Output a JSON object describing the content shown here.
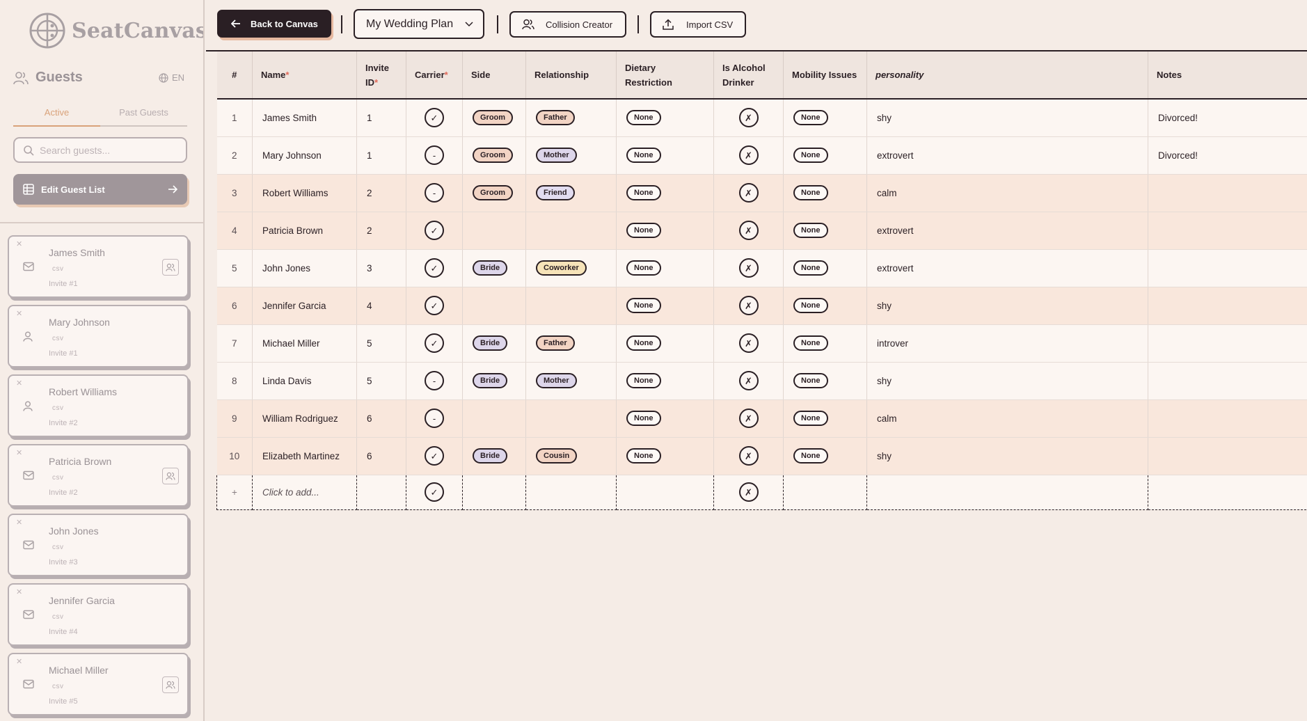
{
  "brand": {
    "name": "SeatCanvas"
  },
  "sidebar": {
    "title": "Guests",
    "lang": "EN",
    "tabs": [
      "Active",
      "Past Guests"
    ],
    "search_placeholder": "Search guests...",
    "edit_button": "Edit Guest List",
    "guests": [
      {
        "name": "James Smith",
        "source": "csv",
        "invite": "Invite #1",
        "icon": "envelope-icon",
        "group": true
      },
      {
        "name": "Mary Johnson",
        "source": "csv",
        "invite": "Invite #1",
        "icon": "person-icon",
        "group": false
      },
      {
        "name": "Robert Williams",
        "source": "csv",
        "invite": "Invite #2",
        "icon": "person-icon",
        "group": false
      },
      {
        "name": "Patricia Brown",
        "source": "csv",
        "invite": "Invite #2",
        "icon": "envelope-icon",
        "group": true
      },
      {
        "name": "John Jones",
        "source": "csv",
        "invite": "Invite #3",
        "icon": "envelope-icon",
        "group": false
      },
      {
        "name": "Jennifer Garcia",
        "source": "csv",
        "invite": "Invite #4",
        "icon": "envelope-icon",
        "group": false
      },
      {
        "name": "Michael Miller",
        "source": "csv",
        "invite": "Invite #5",
        "icon": "envelope-icon",
        "group": true
      }
    ]
  },
  "toolbar": {
    "back_label": "Back to Canvas",
    "plan_name": "My Wedding Plan",
    "collision_label": "Collision Creator",
    "import_label": "Import CSV"
  },
  "table": {
    "headers": {
      "num": "#",
      "name": "Name",
      "invite_1": "Invite",
      "invite_2": "ID",
      "carrier": "Carrier",
      "side": "Side",
      "relationship": "Relationship",
      "dietary_1": "Dietary",
      "dietary_2": "Restriction",
      "alcohol_1": "Is Alcohol",
      "alcohol_2": "Drinker",
      "mobility": "Mobility Issues",
      "personality": "personality",
      "notes": "Notes",
      "required_mark": "*"
    },
    "rows": [
      {
        "num": "1",
        "name": "James Smith",
        "invite": "1",
        "carrier": "✓",
        "side": "Groom",
        "relationship": "Father",
        "dietary": "None",
        "alcohol": "✗",
        "mobility": "None",
        "personality": "shy",
        "notes": "Divorced!",
        "tone": "light"
      },
      {
        "num": "2",
        "name": "Mary Johnson",
        "invite": "1",
        "carrier": "-",
        "side": "Groom",
        "relationship": "Mother",
        "dietary": "None",
        "alcohol": "✗",
        "mobility": "None",
        "personality": "extrovert",
        "notes": "Divorced!",
        "tone": "light"
      },
      {
        "num": "3",
        "name": "Robert Williams",
        "invite": "2",
        "carrier": "-",
        "side": "Groom",
        "relationship": "Friend",
        "dietary": "None",
        "alcohol": "✗",
        "mobility": "None",
        "personality": "calm",
        "notes": "",
        "tone": "peach"
      },
      {
        "num": "4",
        "name": "Patricia Brown",
        "invite": "2",
        "carrier": "✓",
        "side": "",
        "relationship": "",
        "dietary": "None",
        "alcohol": "✗",
        "mobility": "None",
        "personality": "extrovert",
        "notes": "",
        "tone": "peach"
      },
      {
        "num": "5",
        "name": "John Jones",
        "invite": "3",
        "carrier": "✓",
        "side": "Bride",
        "relationship": "Coworker",
        "dietary": "None",
        "alcohol": "✗",
        "mobility": "None",
        "personality": "extrovert",
        "notes": "",
        "tone": "light"
      },
      {
        "num": "6",
        "name": "Jennifer Garcia",
        "invite": "4",
        "carrier": "✓",
        "side": "",
        "relationship": "",
        "dietary": "None",
        "alcohol": "✗",
        "mobility": "None",
        "personality": "shy",
        "notes": "",
        "tone": "peach"
      },
      {
        "num": "7",
        "name": "Michael Miller",
        "invite": "5",
        "carrier": "✓",
        "side": "Bride",
        "relationship": "Father",
        "dietary": "None",
        "alcohol": "✗",
        "mobility": "None",
        "personality": "introver",
        "notes": "",
        "tone": "light"
      },
      {
        "num": "8",
        "name": "Linda Davis",
        "invite": "5",
        "carrier": "-",
        "side": "Bride",
        "relationship": "Mother",
        "dietary": "None",
        "alcohol": "✗",
        "mobility": "None",
        "personality": "shy",
        "notes": "",
        "tone": "light"
      },
      {
        "num": "9",
        "name": "William Rodriguez",
        "invite": "6",
        "carrier": "-",
        "side": "",
        "relationship": "",
        "dietary": "None",
        "alcohol": "✗",
        "mobility": "None",
        "personality": "calm",
        "notes": "",
        "tone": "peach"
      },
      {
        "num": "10",
        "name": "Elizabeth Martinez",
        "invite": "6",
        "carrier": "✓",
        "side": "Bride",
        "relationship": "Cousin",
        "dietary": "None",
        "alcohol": "✗",
        "mobility": "None",
        "personality": "shy",
        "notes": "",
        "tone": "peach"
      }
    ],
    "add_row": {
      "plus": "+",
      "placeholder": "Click to add...",
      "carrier": "✓",
      "alcohol": "✗"
    }
  }
}
